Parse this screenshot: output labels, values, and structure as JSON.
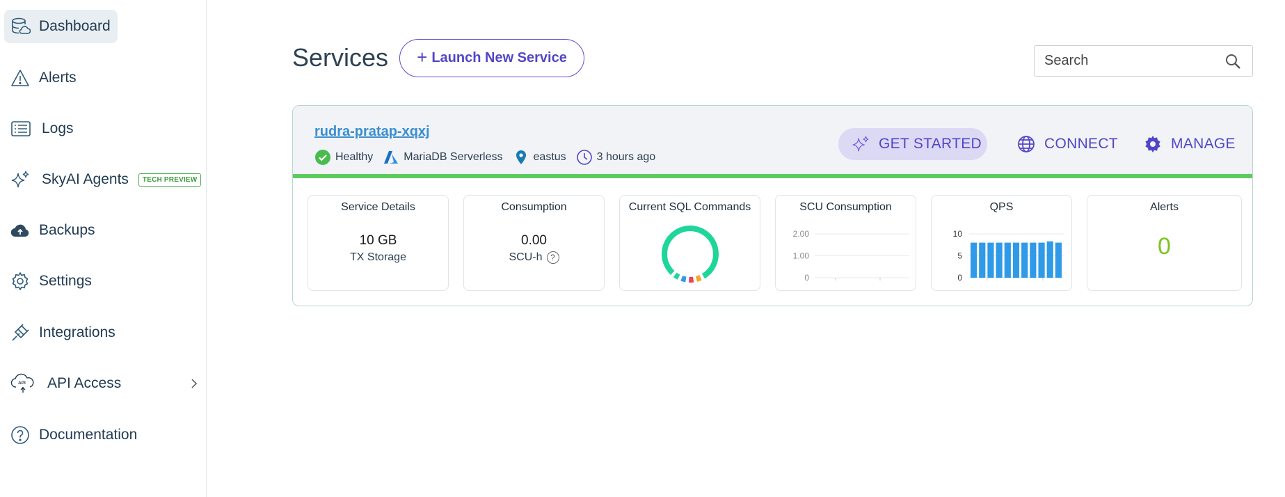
{
  "sidebar": {
    "items": [
      {
        "label": "Dashboard",
        "icon": "database-icon"
      },
      {
        "label": "Alerts",
        "icon": "warning-icon"
      },
      {
        "label": "Logs",
        "icon": "list-icon"
      },
      {
        "label": "SkyAI Agents",
        "icon": "sparkle-icon",
        "badge": "TECH PREVIEW"
      },
      {
        "label": "Backups",
        "icon": "cloud-upload-icon"
      },
      {
        "label": "Settings",
        "icon": "gear-icon"
      },
      {
        "label": "Integrations",
        "icon": "plug-icon"
      },
      {
        "label": "API Access",
        "icon": "cloud-api-icon"
      },
      {
        "label": "Documentation",
        "icon": "help-circle-icon"
      }
    ]
  },
  "header": {
    "title": "Services",
    "launch_label": "Launch New Service",
    "search_placeholder": "Search"
  },
  "service": {
    "name": "rudra-pratap-xqxj",
    "status": "Healthy",
    "type": "MariaDB Serverless",
    "region": "eastus",
    "created": "3 hours ago",
    "actions": {
      "get_started": "GET STARTED",
      "connect": "CONNECT",
      "manage": "MANAGE"
    }
  },
  "tiles": {
    "details": {
      "title": "Service Details",
      "value": "10 GB",
      "sub": "TX Storage"
    },
    "consumption": {
      "title": "Consumption",
      "value": "0.00",
      "sub": "SCU-h",
      "help": "?"
    },
    "sql": {
      "title": "Current SQL Commands"
    },
    "scu": {
      "title": "SCU Consumption"
    },
    "qps": {
      "title": "QPS"
    },
    "alerts": {
      "title": "Alerts",
      "value": "0"
    }
  },
  "colors": {
    "accent": "#5246c6",
    "healthy": "#5ccb5f",
    "link": "#3a8ed0",
    "alerts_ok": "#7cc421",
    "bar": "#2f9ae8"
  },
  "chart_data": [
    {
      "type": "pie",
      "title": "Current SQL Commands",
      "labels": [],
      "values": [
        70,
        4,
        4,
        4,
        4
      ],
      "colors": [
        "#1fd69a",
        "#f5a623",
        "#e8435a",
        "#2f9ae8",
        "#1fd69a"
      ]
    },
    {
      "type": "line",
      "title": "SCU Consumption",
      "y_ticks": [
        "2.00",
        "1.00",
        "0"
      ],
      "ylim": [
        0,
        2
      ],
      "series": [
        {
          "values": []
        }
      ]
    },
    {
      "type": "bar",
      "title": "QPS",
      "y_ticks": [
        "10",
        "5",
        "0"
      ],
      "ylim": [
        0,
        10
      ],
      "values": [
        8,
        8,
        8,
        8,
        8,
        8,
        8,
        8,
        8,
        8.3,
        8
      ]
    }
  ]
}
